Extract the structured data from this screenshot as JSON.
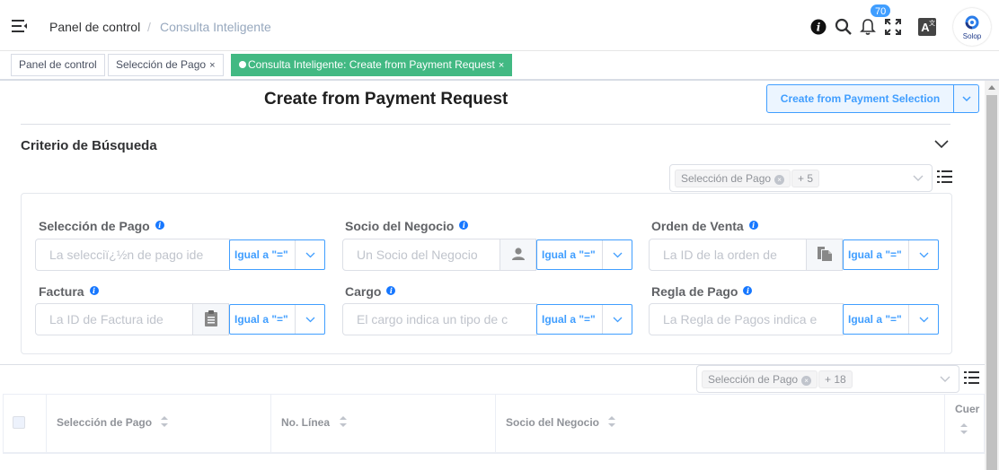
{
  "header": {
    "breadcrumb_home": "Panel de control",
    "breadcrumb_separator": "/",
    "breadcrumb_current": "Consulta Inteligente",
    "notification_count": "70",
    "avatar_text": "Solop"
  },
  "tabs": [
    {
      "label": "Panel de control",
      "closable": false,
      "active": false
    },
    {
      "label": "Selección de Pago",
      "closable": true,
      "active": false
    },
    {
      "label": "Consulta Inteligente: Create from Payment Request",
      "closable": true,
      "active": true
    }
  ],
  "tab_close_glyph": "×",
  "page": {
    "title": "Create from Payment Request",
    "action_button": "Create from Payment Selection"
  },
  "search": {
    "section_title": "Criterio de Búsqueda",
    "field_selector_chip": "Selección de Pago",
    "field_selector_more": "+ 5",
    "fields": [
      {
        "label": "Selección de Pago",
        "placeholder": "La selecciï¿½n de pago ide",
        "operator": "Igual a \"=\"",
        "button_icon": null
      },
      {
        "label": "Socio del Negocio",
        "placeholder": "Un Socio del Negocio",
        "operator": "Igual a \"=\"",
        "button_icon": "user-icon"
      },
      {
        "label": "Orden de Venta",
        "placeholder": "La ID de la orden de",
        "operator": "Igual a \"=\"",
        "button_icon": "documents-icon"
      },
      {
        "label": "Factura",
        "placeholder": "La ID de Factura ide",
        "operator": "Igual a \"=\"",
        "button_icon": "clipboard-icon"
      },
      {
        "label": "Cargo",
        "placeholder": "El cargo indica un tipo de c",
        "operator": "Igual a \"=\"",
        "button_icon": null
      },
      {
        "label": "Regla de Pago",
        "placeholder": "La Regla de Pagos indica e",
        "operator": "Igual a \"=\"",
        "button_icon": null
      }
    ]
  },
  "table": {
    "column_selector_chip": "Selección de Pago",
    "column_selector_more": "+ 18",
    "columns": [
      "Selección de Pago",
      "No. Línea",
      "Socio del Negocio",
      "Cuer"
    ]
  },
  "colors": {
    "accent": "#409eff",
    "active_tab": "#42b983",
    "info_icon": "#1677ff",
    "badge": "#409eff"
  }
}
